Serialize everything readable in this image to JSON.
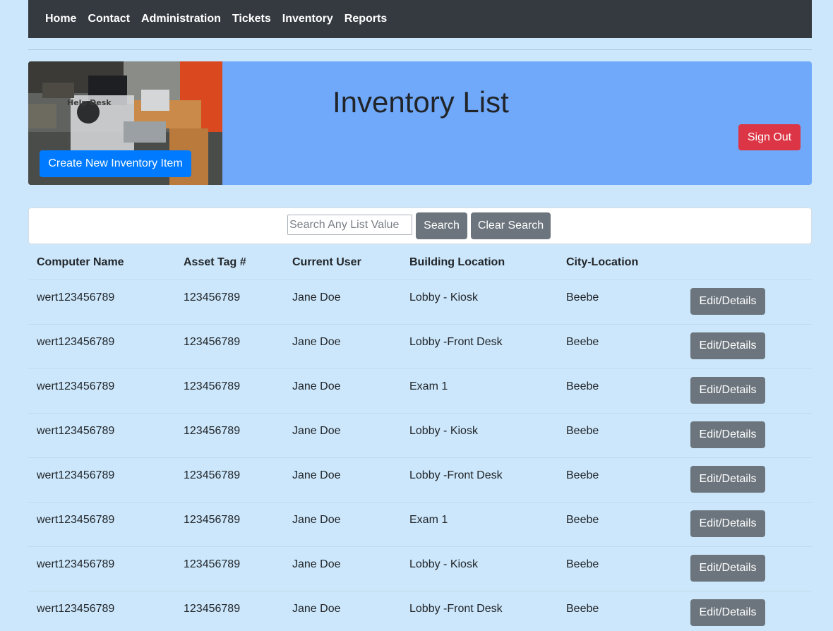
{
  "nav": {
    "items": [
      {
        "label": "Home"
      },
      {
        "label": "Contact"
      },
      {
        "label": "Administration"
      },
      {
        "label": "Tickets"
      },
      {
        "label": "Inventory"
      },
      {
        "label": "Reports"
      }
    ]
  },
  "banner": {
    "title": "Inventory List",
    "create_label": "Create New Inventory Item",
    "signout_label": "Sign Out",
    "photo_sign_text": "Help Desk"
  },
  "search": {
    "placeholder": "Search Any List Value",
    "value": "",
    "search_label": "Search",
    "clear_label": "Clear Search"
  },
  "table": {
    "columns": [
      "Computer Name",
      "Asset Tag #",
      "Current User",
      "Building Location",
      "City-Location"
    ],
    "action_label": "Edit/Details",
    "rows": [
      [
        "wert123456789",
        "123456789",
        "Jane Doe",
        "Lobby - Kiosk",
        "Beebe"
      ],
      [
        "wert123456789",
        "123456789",
        "Jane Doe",
        "Lobby -Front Desk",
        "Beebe"
      ],
      [
        "wert123456789",
        "123456789",
        "Jane Doe",
        "Exam 1",
        "Beebe"
      ],
      [
        "wert123456789",
        "123456789",
        "Jane Doe",
        "Lobby - Kiosk",
        "Beebe"
      ],
      [
        "wert123456789",
        "123456789",
        "Jane Doe",
        "Lobby -Front Desk",
        "Beebe"
      ],
      [
        "wert123456789",
        "123456789",
        "Jane Doe",
        "Exam 1",
        "Beebe"
      ],
      [
        "wert123456789",
        "123456789",
        "Jane Doe",
        "Lobby - Kiosk",
        "Beebe"
      ],
      [
        "wert123456789",
        "123456789",
        "Jane Doe",
        "Lobby -Front Desk",
        "Beebe"
      ]
    ]
  },
  "colors": {
    "page_bg": "#cce7fb",
    "navbar": "#343a40",
    "banner": "#70a9fa",
    "primary": "#007bff",
    "danger": "#dc3545",
    "secondary": "#6c757d"
  }
}
